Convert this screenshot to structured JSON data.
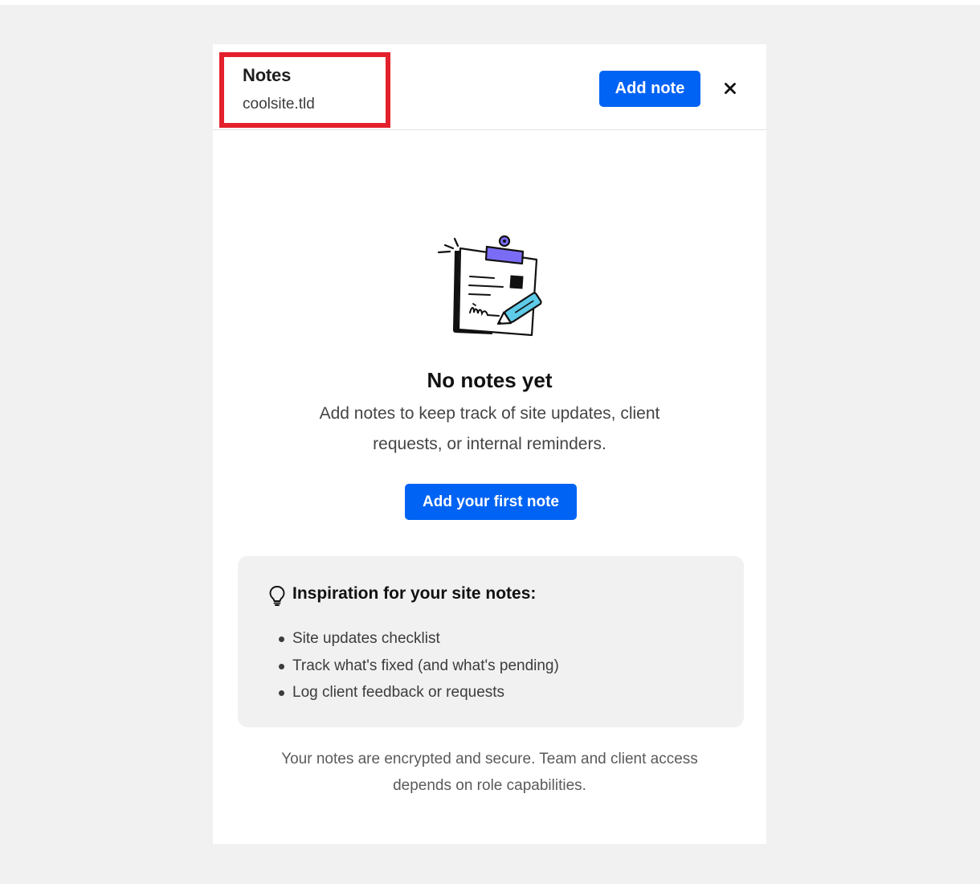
{
  "header": {
    "title": "Notes",
    "subtitle": "coolsite.tld",
    "add_note_label": "Add note",
    "close_label": "×"
  },
  "empty_state": {
    "illustration": "clipboard-pencil-icon",
    "title": "No notes yet",
    "description": "Add notes to keep track of site updates, client requests, or internal reminders.",
    "cta_label": "Add your first note"
  },
  "inspiration": {
    "icon": "lightbulb-icon",
    "title": "Inspiration for your site notes:",
    "items": [
      "Site updates checklist",
      "Track what's fixed (and what's pending)",
      "Log client feedback or requests"
    ]
  },
  "footer": {
    "text": "Your notes are encrypted and secure. Team and client access depends on role capabilities."
  },
  "colors": {
    "accent": "#0063f4",
    "highlight": "#e3202b",
    "background": "#f1f1f1",
    "panel": "#ffffff",
    "clip": "#7b6cf6",
    "pencil": "#5ecbe8"
  }
}
